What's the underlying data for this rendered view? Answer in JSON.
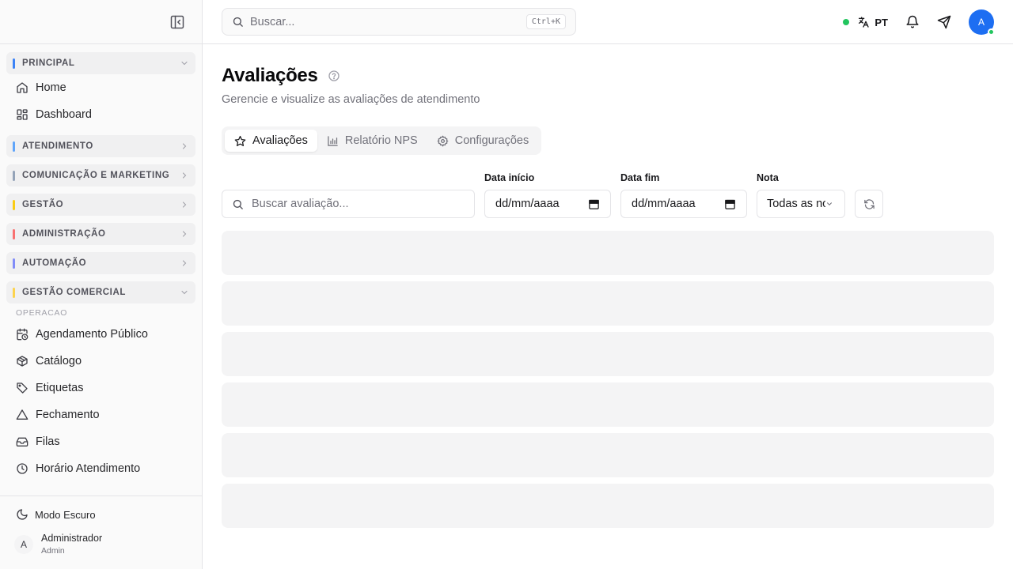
{
  "sidebar": {
    "sections": [
      {
        "label": "PRINCIPAL",
        "color": "#3b82f6",
        "expanded": true
      },
      {
        "label": "ATENDIMENTO",
        "color": "#60a5fa"
      },
      {
        "label": "COMUNICAÇÃO E MARKETING",
        "color": "#94a3b8"
      },
      {
        "label": "GESTÃO",
        "color": "#facc15"
      },
      {
        "label": "ADMINISTRAÇÃO",
        "color": "#f87171"
      },
      {
        "label": "AUTOMAÇÃO",
        "color": "#818cf8"
      },
      {
        "label": "GESTÃO COMERCIAL",
        "color": "#fcd34d",
        "expanded": true
      }
    ],
    "principal_items": [
      {
        "label": "Home",
        "icon": "home-icon"
      },
      {
        "label": "Dashboard",
        "icon": "dashboard-icon"
      }
    ],
    "comercial_subheader": "OPERACAO",
    "comercial_items": [
      {
        "label": "Agendamento Público",
        "icon": "calendar-clock-icon"
      },
      {
        "label": "Catálogo",
        "icon": "package-icon"
      },
      {
        "label": "Etiquetas",
        "icon": "tag-icon"
      },
      {
        "label": "Fechamento",
        "icon": "alert-triangle-icon"
      },
      {
        "label": "Filas",
        "icon": "inbox-icon"
      },
      {
        "label": "Horário Atendimento",
        "icon": "clock-icon"
      }
    ],
    "dark_mode_label": "Modo Escuro",
    "user": {
      "initial": "A",
      "name": "Administrador",
      "role": "Admin"
    }
  },
  "header": {
    "search_placeholder": "Buscar...",
    "shortcut": "Ctrl+K",
    "language": "PT",
    "avatar_initial": "A",
    "status_color": "#22c55e",
    "avatar_color": "#1d6ef2"
  },
  "page": {
    "title": "Avaliações",
    "subtitle": "Gerencie e visualize as avaliações de atendimento",
    "tabs": [
      {
        "label": "Avaliações",
        "icon": "star-icon",
        "active": true
      },
      {
        "label": "Relatório NPS",
        "icon": "bar-chart-icon"
      },
      {
        "label": "Configurações",
        "icon": "settings-icon"
      }
    ],
    "filters": {
      "search_placeholder": "Buscar avaliação...",
      "start_label": "Data início",
      "start_value": "dd/mm/aaaa",
      "end_label": "Data fim",
      "end_value": "dd/mm/aaaa",
      "rating_label": "Nota",
      "rating_value": "Todas as notas"
    }
  }
}
